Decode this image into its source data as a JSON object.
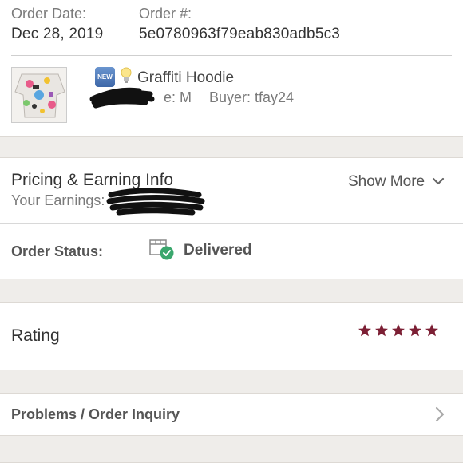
{
  "order": {
    "date_label": "Order Date:",
    "date_value": "Dec 28, 2019",
    "number_label": "Order #:",
    "number_value": "5e0780963f79eab830adb5c3"
  },
  "item": {
    "badge": "NEW",
    "title": "Graffiti Hoodie",
    "size_text": "e: M",
    "buyer_text": "Buyer: tfay24"
  },
  "pricing": {
    "title": "Pricing & Earning Info",
    "earnings_label": "Your Earnings:",
    "show_more": "Show More"
  },
  "status": {
    "label": "Order Status:",
    "value": "Delivered",
    "accent": "#3aa76d"
  },
  "rating": {
    "label": "Rating",
    "stars": 5,
    "star_color": "#7c1f34"
  },
  "problems": {
    "label": "Problems / Order Inquiry"
  },
  "colors": {
    "separator_band": "#efedea",
    "redaction": "#111111"
  }
}
